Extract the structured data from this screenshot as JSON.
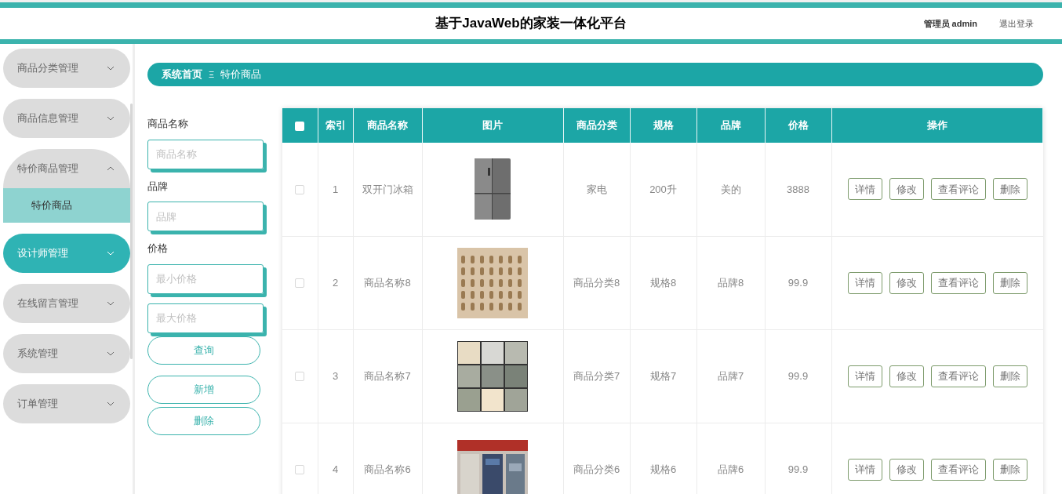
{
  "header": {
    "title": "基于JavaWeb的家装一体化平台",
    "user": "管理员 admin",
    "logout": "退出登录"
  },
  "sidebar": {
    "items": [
      {
        "label": "商品分类管理",
        "expanded": false,
        "active": false
      },
      {
        "label": "商品信息管理",
        "expanded": false,
        "active": false
      },
      {
        "label": "特价商品管理",
        "expanded": true,
        "active": false,
        "children": [
          {
            "label": "特价商品",
            "selected": true
          }
        ]
      },
      {
        "label": "设计师管理",
        "expanded": false,
        "active": true
      },
      {
        "label": "在线留言管理",
        "expanded": false,
        "active": false
      },
      {
        "label": "系统管理",
        "expanded": false,
        "active": false
      },
      {
        "label": "订单管理",
        "expanded": false,
        "active": false
      }
    ]
  },
  "breadcrumb": {
    "home": "系统首页",
    "separator": "Ξ",
    "current": "特价商品"
  },
  "filters": [
    {
      "label": "商品名称",
      "fields": [
        {
          "placeholder": "商品名称"
        }
      ]
    },
    {
      "label": "品牌",
      "fields": [
        {
          "placeholder": "品牌"
        }
      ]
    },
    {
      "label": "价格",
      "fields": [
        {
          "placeholder": "最小价格"
        },
        {
          "placeholder": "最大价格"
        }
      ]
    }
  ],
  "filter_buttons": [
    "查询",
    "新增",
    "删除"
  ],
  "table": {
    "select_all_checked": false,
    "columns": [
      "索引",
      "商品名称",
      "图片",
      "商品分类",
      "规格",
      "品牌",
      "价格",
      "操作"
    ],
    "rows": [
      {
        "checked": false,
        "index": "1",
        "name": "双开门冰箱",
        "category": "家电",
        "spec": "200升",
        "brand": "美的",
        "price": "3888",
        "actions": [
          "详情",
          "修改",
          "查看评论",
          "删除"
        ]
      },
      {
        "checked": false,
        "index": "2",
        "name": "商品名称8",
        "category": "商品分类8",
        "spec": "规格8",
        "brand": "品牌8",
        "price": "99.9",
        "actions": [
          "详情",
          "修改",
          "查看评论",
          "删除"
        ]
      },
      {
        "checked": false,
        "index": "3",
        "name": "商品名称7",
        "category": "商品分类7",
        "spec": "规格7",
        "brand": "品牌7",
        "price": "99.9",
        "actions": [
          "详情",
          "修改",
          "查看评论",
          "删除"
        ]
      },
      {
        "checked": false,
        "index": "4",
        "name": "商品名称6",
        "category": "商品分类6",
        "spec": "规格6",
        "brand": "品牌6",
        "price": "99.9",
        "actions": [
          "详情",
          "修改",
          "查看评论",
          "删除"
        ]
      }
    ]
  }
}
